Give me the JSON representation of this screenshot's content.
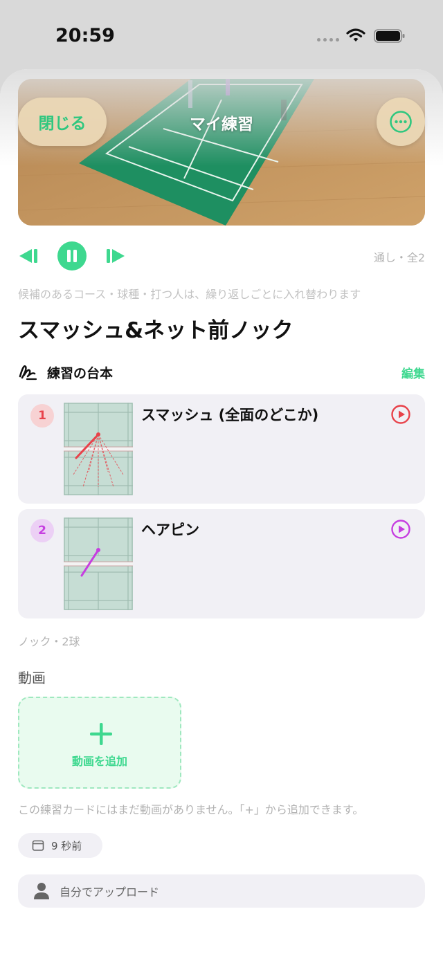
{
  "status_bar": {
    "time": "20:59"
  },
  "nav": {
    "close_label": "閉じる",
    "title": "マイ練習"
  },
  "playback": {
    "count_label": "通し・全2"
  },
  "hint": "候補のあるコース・球種・打つ人は、繰り返しごとに入れ替わります",
  "drill": {
    "title": "スマッシュ&ネット前ノック"
  },
  "script": {
    "label": "練習の台本",
    "edit_label": "編集",
    "shots": [
      {
        "number": "1",
        "name": "スマッシュ (全面のどこか)",
        "color": "#e8424a"
      },
      {
        "number": "2",
        "name": "ヘアピン",
        "color": "#c63ee0"
      }
    ]
  },
  "knock_count": "ノック・2球",
  "videos": {
    "section_label": "動画",
    "add_label": "動画を追加",
    "empty_note": "この練習カードにはまだ動画がありません。「+」から追加できます。"
  },
  "meta": {
    "time_ago": "9 秒前",
    "uploader": "自分でアップロード"
  },
  "colors": {
    "accent": "#3ed88f",
    "court": "#1e8f61",
    "floor": "#c79a62"
  }
}
